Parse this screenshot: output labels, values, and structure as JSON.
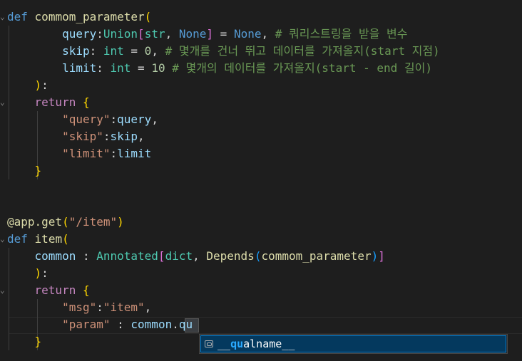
{
  "code_lines": [
    {
      "tokens": [
        {
          "c": "kw",
          "t": "def"
        },
        {
          "c": "pl",
          "t": " "
        },
        {
          "c": "fn",
          "t": "commom_parameter"
        },
        {
          "c": "b1",
          "t": "("
        }
      ]
    },
    {
      "tokens": [
        {
          "c": "pl",
          "t": "        "
        },
        {
          "c": "var",
          "t": "query"
        },
        {
          "c": "pl",
          "t": ":"
        },
        {
          "c": "ty",
          "t": "Union"
        },
        {
          "c": "b2",
          "t": "["
        },
        {
          "c": "ty",
          "t": "str"
        },
        {
          "c": "pl",
          "t": ", "
        },
        {
          "c": "kw",
          "t": "None"
        },
        {
          "c": "b2",
          "t": "]"
        },
        {
          "c": "pl",
          "t": " = "
        },
        {
          "c": "kw",
          "t": "None"
        },
        {
          "c": "pl",
          "t": ", "
        },
        {
          "c": "com",
          "t": "# 쿼리스트링을 받을 변수"
        }
      ]
    },
    {
      "tokens": [
        {
          "c": "pl",
          "t": "        "
        },
        {
          "c": "var",
          "t": "skip"
        },
        {
          "c": "pl",
          "t": ": "
        },
        {
          "c": "ty",
          "t": "int"
        },
        {
          "c": "pl",
          "t": " = "
        },
        {
          "c": "num",
          "t": "0"
        },
        {
          "c": "pl",
          "t": ", "
        },
        {
          "c": "com",
          "t": "# 몇개를 건너 뛰고 데이터를 가져올지(start 지점)"
        }
      ]
    },
    {
      "tokens": [
        {
          "c": "pl",
          "t": "        "
        },
        {
          "c": "var",
          "t": "limit"
        },
        {
          "c": "pl",
          "t": ": "
        },
        {
          "c": "ty",
          "t": "int"
        },
        {
          "c": "pl",
          "t": " = "
        },
        {
          "c": "num",
          "t": "10"
        },
        {
          "c": "pl",
          "t": " "
        },
        {
          "c": "com",
          "t": "# 몇개의 데이터를 가져올지(start - end 길이)"
        }
      ]
    },
    {
      "tokens": [
        {
          "c": "pl",
          "t": "    "
        },
        {
          "c": "b1",
          "t": ")"
        },
        {
          "c": "pl",
          "t": ":"
        }
      ]
    },
    {
      "tokens": [
        {
          "c": "pl",
          "t": "    "
        },
        {
          "c": "ctl",
          "t": "return"
        },
        {
          "c": "pl",
          "t": " "
        },
        {
          "c": "b1",
          "t": "{"
        }
      ]
    },
    {
      "tokens": [
        {
          "c": "pl",
          "t": "        "
        },
        {
          "c": "str",
          "t": "\"query\""
        },
        {
          "c": "pl",
          "t": ":"
        },
        {
          "c": "var",
          "t": "query"
        },
        {
          "c": "pl",
          "t": ","
        }
      ]
    },
    {
      "tokens": [
        {
          "c": "pl",
          "t": "        "
        },
        {
          "c": "str",
          "t": "\"skip\""
        },
        {
          "c": "pl",
          "t": ":"
        },
        {
          "c": "var",
          "t": "skip"
        },
        {
          "c": "pl",
          "t": ","
        }
      ]
    },
    {
      "tokens": [
        {
          "c": "pl",
          "t": "        "
        },
        {
          "c": "str",
          "t": "\"limit\""
        },
        {
          "c": "pl",
          "t": ":"
        },
        {
          "c": "var",
          "t": "limit"
        }
      ]
    },
    {
      "tokens": [
        {
          "c": "pl",
          "t": "    "
        },
        {
          "c": "b1",
          "t": "}"
        }
      ]
    },
    {
      "tokens": []
    },
    {
      "tokens": []
    },
    {
      "tokens": [
        {
          "c": "fn",
          "t": "@app.get"
        },
        {
          "c": "b1",
          "t": "("
        },
        {
          "c": "str",
          "t": "\"/item\""
        },
        {
          "c": "b1",
          "t": ")"
        }
      ]
    },
    {
      "tokens": [
        {
          "c": "kw",
          "t": "def"
        },
        {
          "c": "pl",
          "t": " "
        },
        {
          "c": "fn",
          "t": "item"
        },
        {
          "c": "b1",
          "t": "("
        }
      ]
    },
    {
      "tokens": [
        {
          "c": "pl",
          "t": "    "
        },
        {
          "c": "var",
          "t": "common"
        },
        {
          "c": "pl",
          "t": " : "
        },
        {
          "c": "ty",
          "t": "Annotated"
        },
        {
          "c": "b2",
          "t": "["
        },
        {
          "c": "ty",
          "t": "dict"
        },
        {
          "c": "pl",
          "t": ", "
        },
        {
          "c": "fn",
          "t": "Depends"
        },
        {
          "c": "b3",
          "t": "("
        },
        {
          "c": "fn",
          "t": "commom_parameter"
        },
        {
          "c": "b3",
          "t": ")"
        },
        {
          "c": "b2",
          "t": "]"
        }
      ]
    },
    {
      "tokens": [
        {
          "c": "pl",
          "t": "    "
        },
        {
          "c": "b1",
          "t": ")"
        },
        {
          "c": "pl",
          "t": ":"
        }
      ]
    },
    {
      "tokens": [
        {
          "c": "pl",
          "t": "    "
        },
        {
          "c": "ctl",
          "t": "return"
        },
        {
          "c": "pl",
          "t": " "
        },
        {
          "c": "b1",
          "t": "{"
        }
      ]
    },
    {
      "tokens": [
        {
          "c": "pl",
          "t": "        "
        },
        {
          "c": "str",
          "t": "\"msg\""
        },
        {
          "c": "pl",
          "t": ":"
        },
        {
          "c": "str",
          "t": "\"item\""
        },
        {
          "c": "pl",
          "t": ","
        }
      ]
    },
    {
      "tokens": [
        {
          "c": "pl",
          "t": "        "
        },
        {
          "c": "str",
          "t": "\"param\""
        },
        {
          "c": "pl",
          "t": " : "
        },
        {
          "c": "var",
          "t": "common"
        },
        {
          "c": "pl",
          "t": "."
        },
        {
          "c": "var",
          "t": "qu"
        }
      ]
    },
    {
      "tokens": [
        {
          "c": "pl",
          "t": "    "
        },
        {
          "c": "b1",
          "t": "}"
        }
      ]
    }
  ],
  "suggest": {
    "prefix": "__",
    "match": "qu",
    "suffix": "alname__"
  }
}
